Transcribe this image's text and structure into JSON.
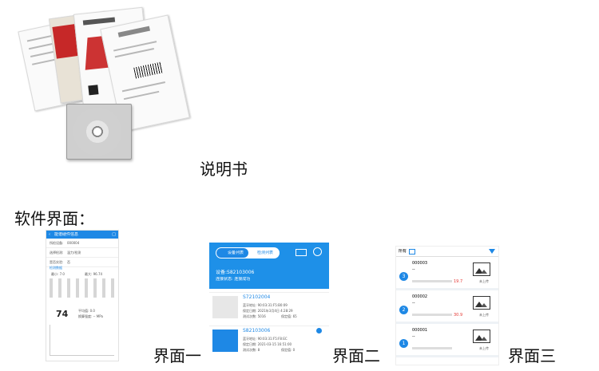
{
  "captions": {
    "manual": "说明书",
    "software": "软件界面：",
    "ui1": "界面一",
    "ui2": "界面二",
    "ui3": "界面三"
  },
  "screen1": {
    "header": "能谱硬件信息",
    "fields": [
      {
        "label": "所检设备:",
        "value": "000004"
      },
      {
        "label": "选择检测:",
        "value": "温力/检测"
      },
      {
        "label": "是否实验:",
        "value": "否"
      }
    ],
    "section": "检测数据",
    "stats": [
      "最小: 7.0",
      "最大: 96.74"
    ],
    "big_value": "74",
    "avg": "平均值: 0.0",
    "converted": "换算强度: -- MPa"
  },
  "screen2": {
    "tab_active": "设备列表",
    "tab_inactive": "检测列表",
    "device_label": "设备:S82103006",
    "status_label": "连接状态: 连接成功",
    "cards": [
      {
        "id": "S72102004",
        "l1": "蓝牙地址: 90:03:31:F5:B0:09",
        "l2": "保定日期: 2021年3月4日 4:28:29",
        "l3a": "测试次数: 5016",
        "l3b": "保定值: 65"
      },
      {
        "id": "S82103006",
        "l1": "蓝牙地址: 90:03:31:F5:F8:EC",
        "l2": "保定日期: 2021-03-15 16:51:00",
        "l3a": "测试次数: 8",
        "l3b": "保定值: 0"
      }
    ]
  },
  "screen3": {
    "header": "所有",
    "items": [
      {
        "n": "3",
        "id": "000003",
        "dash": "--",
        "red": "19.7",
        "upload": "未上传"
      },
      {
        "n": "2",
        "id": "000002",
        "dash": "--",
        "red": "30.9",
        "upload": "未上传"
      },
      {
        "n": "1",
        "id": "000001",
        "dash": "--",
        "red": "",
        "upload": "未上传"
      }
    ]
  },
  "colors": {
    "accent": "#1e88e5",
    "red": "#e53935"
  }
}
